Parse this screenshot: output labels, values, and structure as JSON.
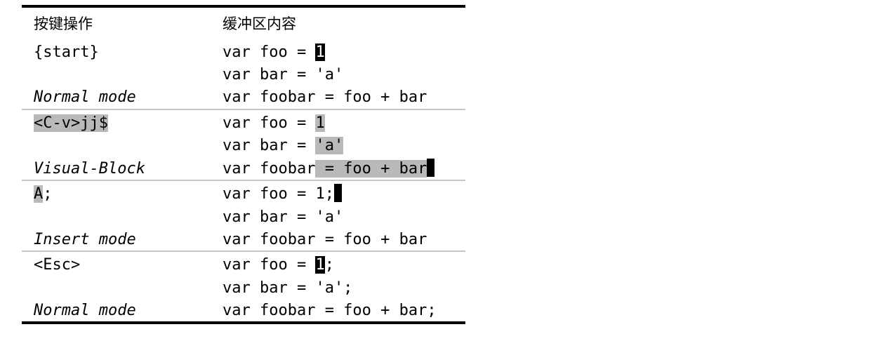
{
  "header": {
    "keystrokes": "按键操作",
    "buffer_contents": "缓冲区内容"
  },
  "steps": [
    {
      "keys": "{start}",
      "mode": "Normal mode",
      "lines": {
        "l1": {
          "pre": "var foo = ",
          "cursor": "1"
        },
        "l2": {
          "text": "var bar = 'a'"
        },
        "l3": {
          "text": "var foobar = foo + bar"
        }
      }
    },
    {
      "keys": "<C-v>jj$",
      "mode": "Visual-Block",
      "lines": {
        "l1": {
          "pre": "var foo = ",
          "sel": "1"
        },
        "l2": {
          "pre": "var bar = ",
          "sel": "'a'"
        },
        "l3": {
          "pre": "var foobar",
          "sel": " = foo + bar"
        }
      }
    },
    {
      "keys_hl": "A",
      "keys_rest": ";",
      "mode": "Insert mode",
      "lines": {
        "l1": {
          "text": "var foo = 1;"
        },
        "l2": {
          "text": "var bar = 'a'"
        },
        "l3": {
          "text": "var foobar = foo + bar"
        }
      }
    },
    {
      "keys": "<Esc>",
      "mode": "Normal mode",
      "lines": {
        "l1": {
          "pre": "var foo = ",
          "cursor": "1",
          "post": ";"
        },
        "l2": {
          "text": "var bar = 'a';"
        },
        "l3": {
          "text": "var foobar = foo + bar;"
        }
      }
    }
  ]
}
